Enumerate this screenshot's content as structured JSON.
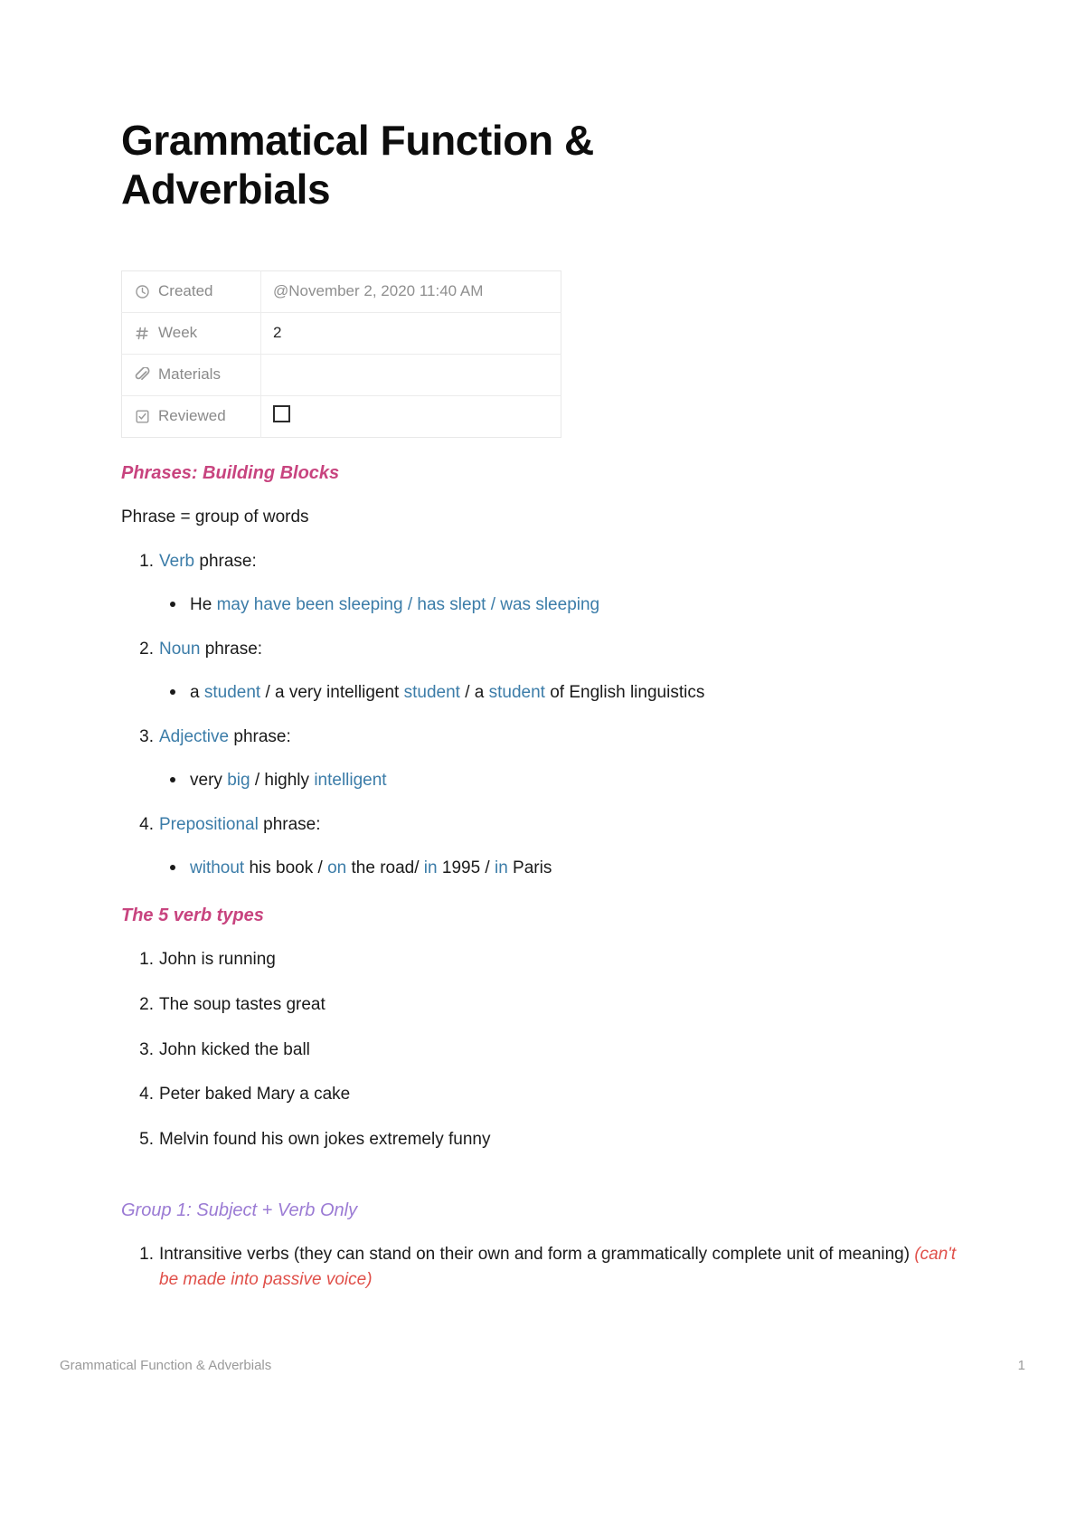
{
  "document": {
    "title": "Grammatical Function & Adverbials"
  },
  "properties": {
    "rows": [
      {
        "icon": "clock-icon",
        "key": "Created",
        "value": "@November 2, 2020 11:40 AM",
        "type": "text",
        "muted": true
      },
      {
        "icon": "hash-icon",
        "key": "Week",
        "value": "2",
        "type": "text",
        "muted": false
      },
      {
        "icon": "paperclip-icon",
        "key": "Materials",
        "value": "",
        "type": "text",
        "muted": false
      },
      {
        "icon": "checkbox-icon",
        "key": "Reviewed",
        "value": "",
        "type": "checkbox",
        "checked": false
      }
    ]
  },
  "sections": {
    "phrases": {
      "heading": "Phrases: Building Blocks",
      "definition": "Phrase = group of words",
      "items": [
        {
          "marker": "1.",
          "term": "Verb",
          "rest": " phrase:",
          "bullet_marker": "•",
          "bullet": {
            "p1": "He ",
            "b1": "may have been sleeping / has slept / was sleeping",
            "p2": "",
            "b2": "",
            "p3": "",
            "b3": "",
            "p4": ""
          }
        },
        {
          "marker": "2.",
          "term": "Noun",
          "rest": " phrase:",
          "bullet_marker": "•",
          "bullet": {
            "p1": "a ",
            "b1": "student",
            "p2": " / a very intelligent ",
            "b2": "student",
            "p3": " / a ",
            "b3": "student",
            "p4": " of English linguistics"
          }
        },
        {
          "marker": "3.",
          "term": "Adjective",
          "rest": " phrase:",
          "bullet_marker": "•",
          "bullet": {
            "p1": "very ",
            "b1": "big",
            "p2": " / highly ",
            "b2": "intelligent",
            "p3": "",
            "b3": "",
            "p4": ""
          }
        },
        {
          "marker": "4.",
          "term": "Prepositional",
          "rest": " phrase:",
          "bullet_marker": "•",
          "bullet": {
            "p1": "",
            "b1": "without",
            "p2": " his book / ",
            "b2": "on",
            "p3": " the road/ ",
            "b3": "in",
            "p4": " 1995 / ",
            "b4": "in",
            "p5": " Paris"
          }
        }
      ]
    },
    "verb_types": {
      "heading": "The 5 verb types",
      "items": [
        {
          "marker": "1.",
          "text": "John is running"
        },
        {
          "marker": "2.",
          "text": "The soup tastes great"
        },
        {
          "marker": "3.",
          "text": "John kicked the ball"
        },
        {
          "marker": "4.",
          "text": "Peter baked Mary a cake"
        },
        {
          "marker": "5.",
          "text": "Melvin found his own jokes extremely funny"
        }
      ]
    },
    "group1": {
      "heading": "Group 1: Subject + Verb Only",
      "items": [
        {
          "marker": "1.",
          "text": "Intransitive verbs (they can stand on their own and form a grammatically complete unit of meaning) ",
          "note": "(can't be made into passive voice)"
        }
      ]
    }
  },
  "footer": {
    "left": "Grammatical Function & Adverbials",
    "page_number": "1"
  },
  "colors": {
    "accent_pink": "#c8447f",
    "accent_purple": "#9b7bd4",
    "accent_blue": "#3b7ca8",
    "accent_red": "#e0504a"
  }
}
